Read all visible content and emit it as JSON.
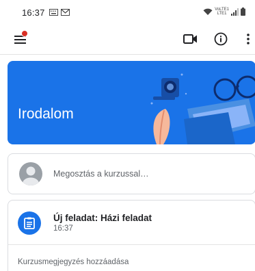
{
  "status_bar": {
    "time": "16:37",
    "network_label": "VoLTE1",
    "network_sub": "LTE1"
  },
  "app_bar": {
    "icons": [
      "menu-icon",
      "video-icon",
      "info-icon",
      "more-vert-icon"
    ],
    "notification_color": "#d93025"
  },
  "banner": {
    "title": "Irodalom",
    "color": "#1a73e8"
  },
  "share": {
    "placeholder": "Megosztás a kurzussal…"
  },
  "stream": {
    "items": [
      {
        "title": "Új feladat: Házi feladat",
        "time": "16:37",
        "comment_label": "Kurzusmegjegyzés hozzáadása"
      }
    ]
  },
  "colors": {
    "accent": "#1a73e8",
    "text_primary": "#202124",
    "text_secondary": "#5f6368"
  }
}
